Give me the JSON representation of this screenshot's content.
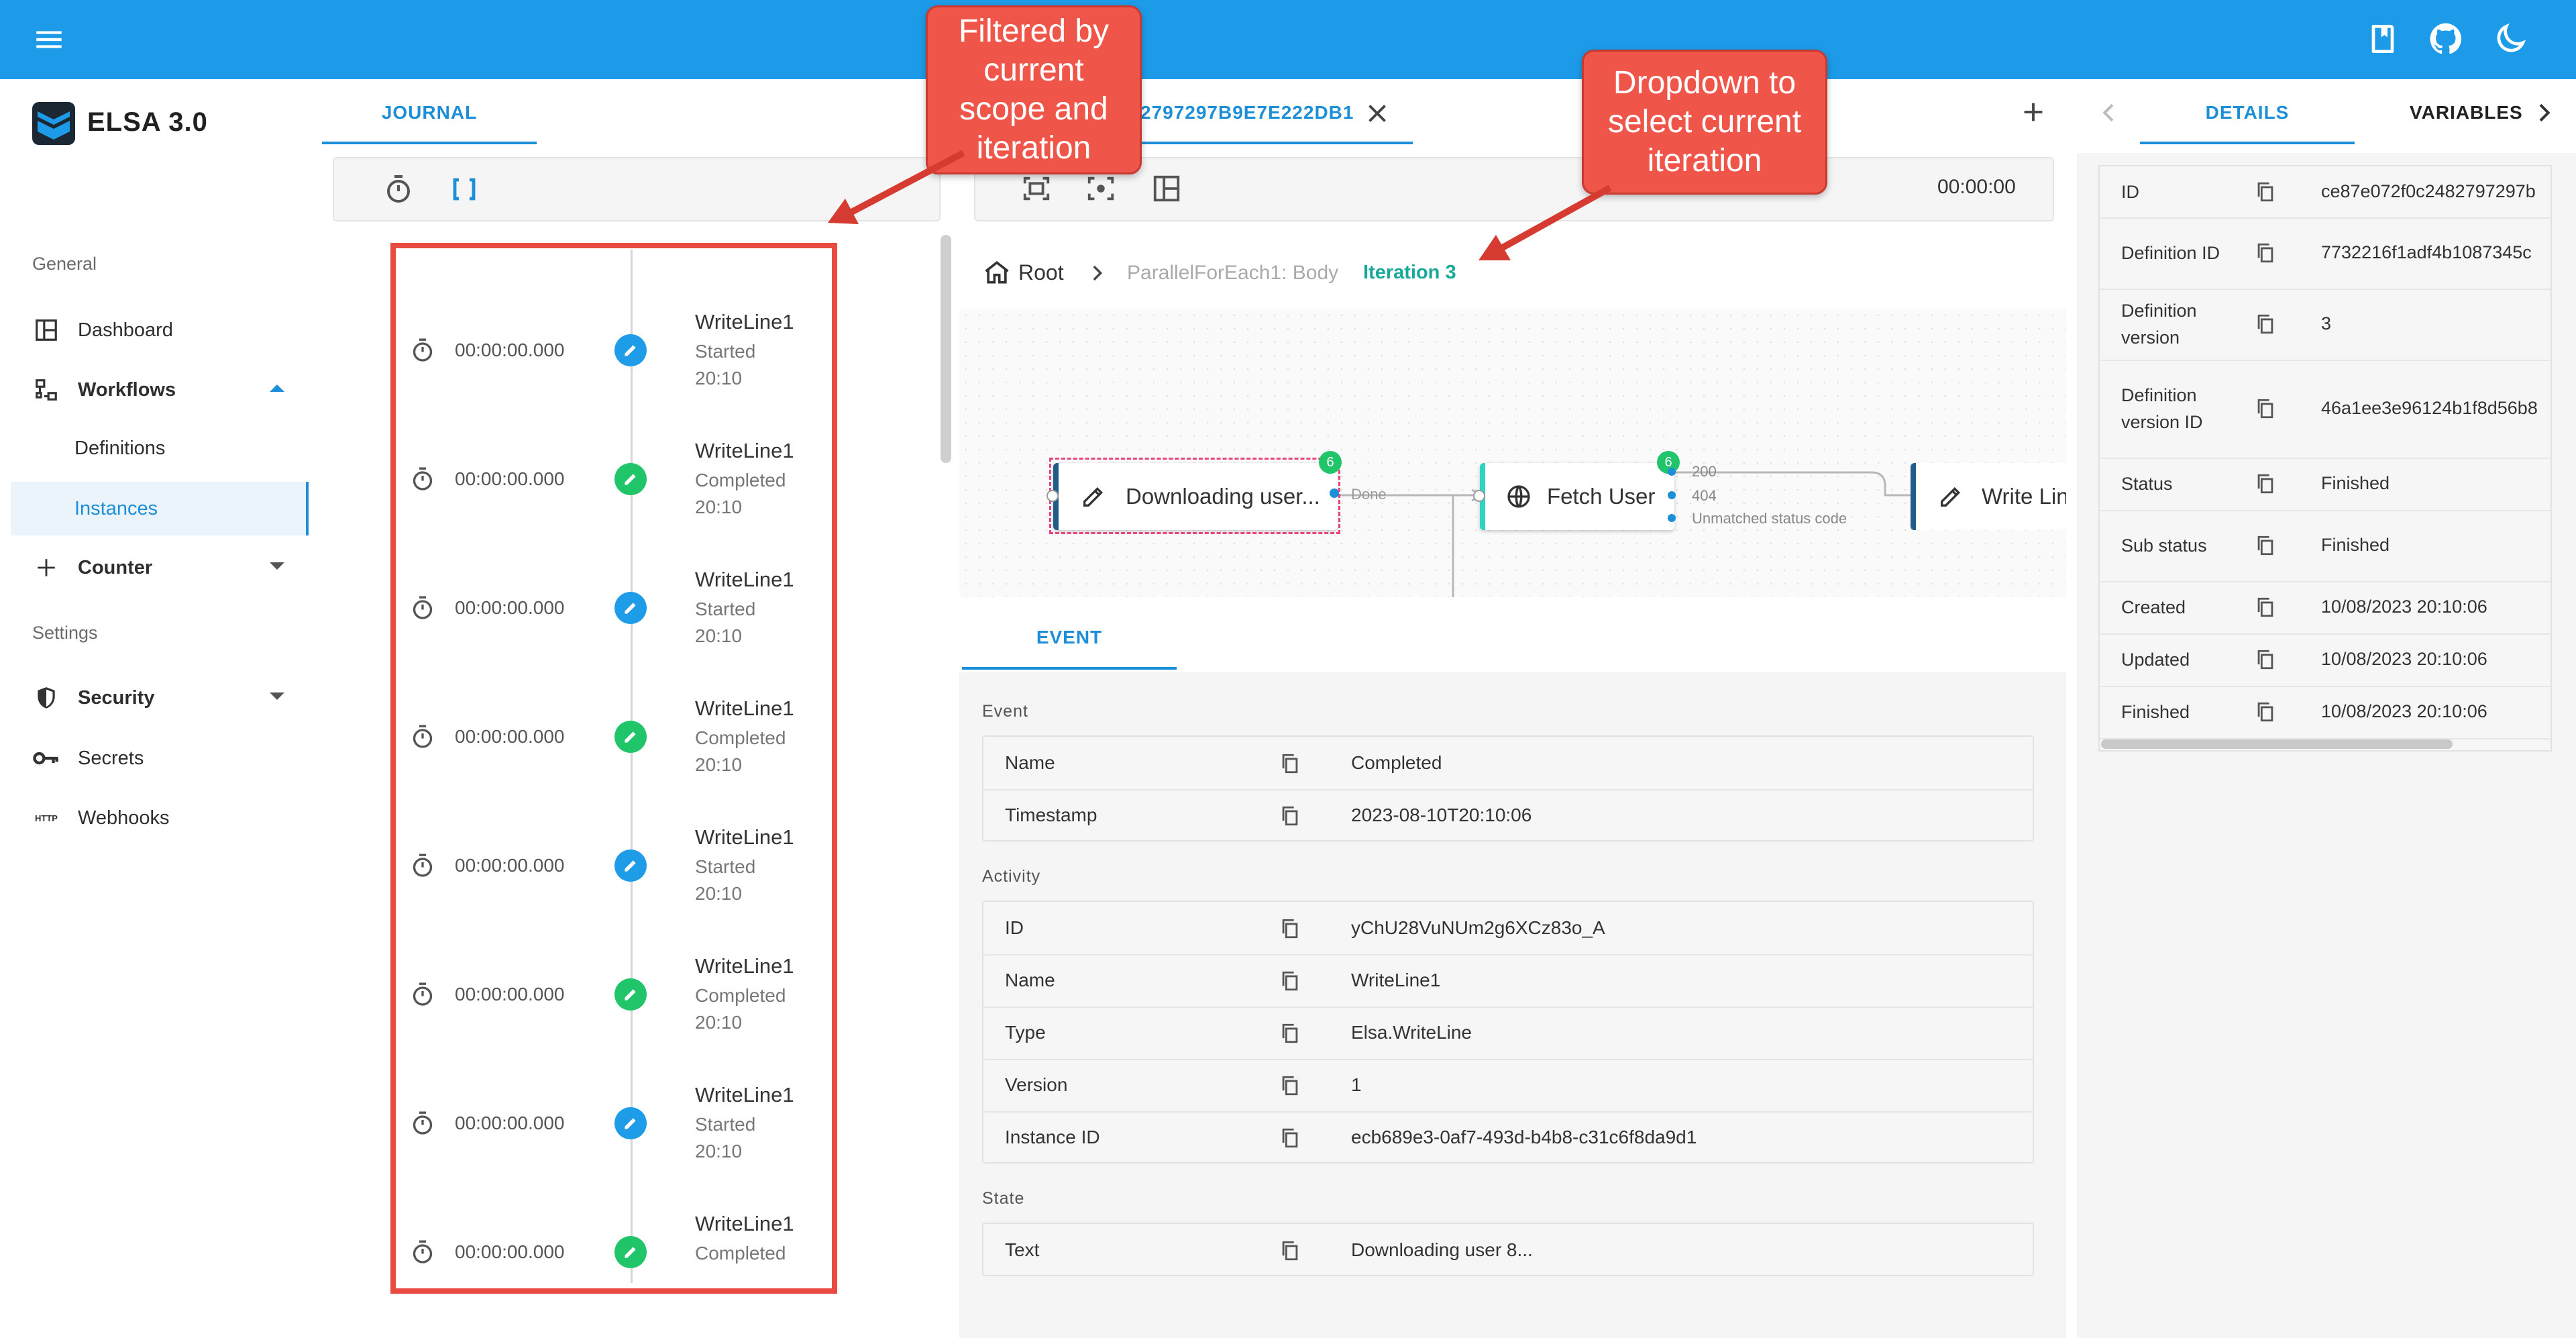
{
  "app": {
    "title": "ELSA 3.0"
  },
  "sidebar": {
    "section_general": "General",
    "dashboard": "Dashboard",
    "workflows": "Workflows",
    "definitions": "Definitions",
    "instances": "Instances",
    "counter": "Counter",
    "section_settings": "Settings",
    "security": "Security",
    "secrets": "Secrets",
    "webhooks": "Webhooks",
    "webhooks_icon_text": "HTTP"
  },
  "journal": {
    "tab": "JOURNAL",
    "items": [
      {
        "time": "00:00:00.000",
        "name": "WriteLine1",
        "status": "Started",
        "clock": "20:10",
        "kind": "started"
      },
      {
        "time": "00:00:00.000",
        "name": "WriteLine1",
        "status": "Completed",
        "clock": "20:10",
        "kind": "completed"
      },
      {
        "time": "00:00:00.000",
        "name": "WriteLine1",
        "status": "Started",
        "clock": "20:10",
        "kind": "started"
      },
      {
        "time": "00:00:00.000",
        "name": "WriteLine1",
        "status": "Completed",
        "clock": "20:10",
        "kind": "completed"
      },
      {
        "time": "00:00:00.000",
        "name": "WriteLine1",
        "status": "Started",
        "clock": "20:10",
        "kind": "started"
      },
      {
        "time": "00:00:00.000",
        "name": "WriteLine1",
        "status": "Completed",
        "clock": "20:10",
        "kind": "completed"
      },
      {
        "time": "00:00:00.000",
        "name": "WriteLine1",
        "status": "Started",
        "clock": "20:10",
        "kind": "started"
      },
      {
        "time": "00:00:00.000",
        "name": "WriteLine1",
        "status": "Completed",
        "clock": "",
        "kind": "completed"
      }
    ]
  },
  "designer": {
    "instance_tab": "2797297B9E7E222DB1",
    "timer": "00:00:00",
    "breadcrumb": {
      "root": "Root",
      "parent": "ParallelForEach1: Body",
      "current": "Iteration 3"
    },
    "nodes": {
      "download": "Downloading user...",
      "download_badge": "6",
      "done_label": "Done",
      "fetch": "Fetch User",
      "fetch_badge": "6",
      "outcomes": [
        "200",
        "404",
        "Unmatched status code"
      ],
      "write": "Write Lin"
    }
  },
  "event_panel": {
    "tab": "EVENT",
    "event_group": "Event",
    "event_rows": [
      {
        "key": "Name",
        "value": "Completed"
      },
      {
        "key": "Timestamp",
        "value": "2023-08-10T20:10:06"
      }
    ],
    "activity_group": "Activity",
    "activity_rows": [
      {
        "key": "ID",
        "value": "yChU28VuNUm2g6XCz83o_A"
      },
      {
        "key": "Name",
        "value": "WriteLine1"
      },
      {
        "key": "Type",
        "value": "Elsa.WriteLine"
      },
      {
        "key": "Version",
        "value": "1"
      },
      {
        "key": "Instance ID",
        "value": "ecb689e3-0af7-493d-b4b8-c31c6f8da9d1"
      }
    ],
    "state_group": "State",
    "state_rows": [
      {
        "key": "Text",
        "value": "Downloading user 8..."
      }
    ]
  },
  "details": {
    "tab_details": "DETAILS",
    "tab_variables": "VARIABLES",
    "rows": [
      {
        "key": "ID",
        "value": "ce87e072f0c2482797297b"
      },
      {
        "key": "Definition ID",
        "value": "7732216f1adf4b1087345c"
      },
      {
        "key": "Definition version",
        "value": "3"
      },
      {
        "key": "Definition version ID",
        "value": "46a1ee3e96124b1f8d56b8"
      },
      {
        "key": "Status",
        "value": "Finished"
      },
      {
        "key": "Sub status",
        "value": "Finished"
      },
      {
        "key": "Created",
        "value": "10/08/2023 20:10:06"
      },
      {
        "key": "Updated",
        "value": "10/08/2023 20:10:06"
      },
      {
        "key": "Finished",
        "value": "10/08/2023 20:10:06"
      }
    ]
  },
  "callouts": {
    "filtered": "Filtered by current scope and iteration",
    "dropdown": "Dropdown to select current iteration"
  },
  "colors": {
    "accent": "#1d9be8",
    "callout": "#f0554a",
    "success": "#20c56a"
  }
}
